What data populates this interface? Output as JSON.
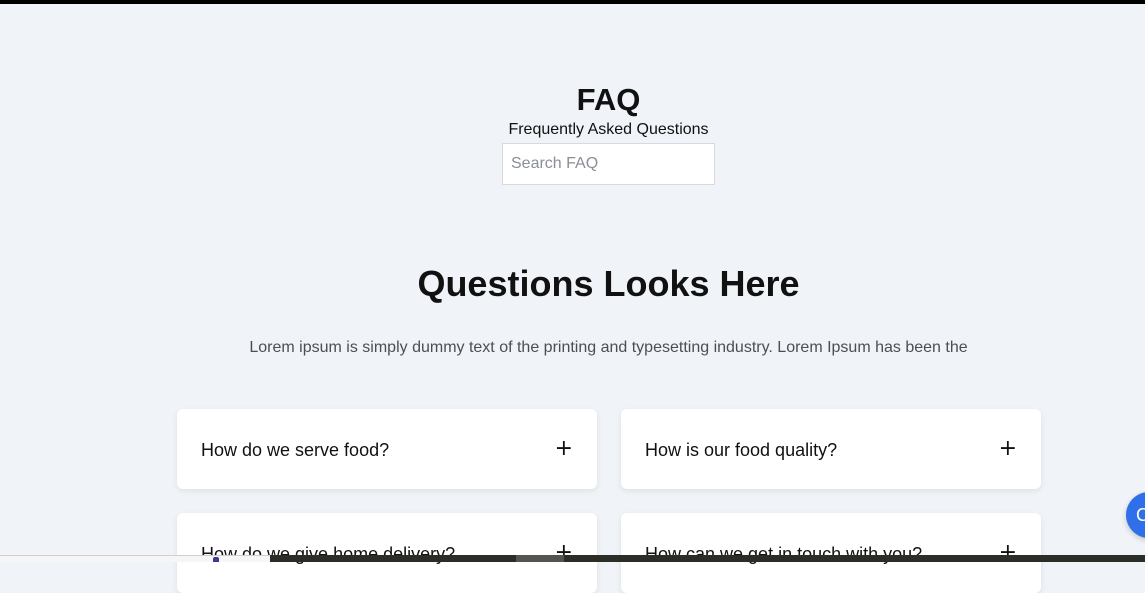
{
  "header": {
    "title": "FAQ",
    "subtitle": "Frequently Asked Questions"
  },
  "search": {
    "placeholder": "Search FAQ",
    "value": ""
  },
  "section": {
    "title": "Questions Looks Here",
    "description": "Lorem ipsum is simply dummy text of the printing and typesetting industry. Lorem Ipsum has been the"
  },
  "faqs": [
    {
      "question": "How do we serve food?",
      "toggle_icon": "plus-icon",
      "toggle": "+"
    },
    {
      "question": "How is our food quality?",
      "toggle_icon": "plus-icon",
      "toggle": "+"
    },
    {
      "question": "How do we give home delivery?",
      "toggle_icon": "plus-icon",
      "toggle": "+"
    },
    {
      "question": "How can we get in touch with you?",
      "toggle_icon": "plus-icon",
      "toggle": "+"
    }
  ],
  "chat_button": {
    "icon": "chat-icon",
    "label": "C"
  },
  "colors": {
    "background": "#f0f3f7",
    "card": "#ffffff",
    "accent": "#2f6fea",
    "text": "#111111",
    "muted_text": "#4a4f57"
  }
}
